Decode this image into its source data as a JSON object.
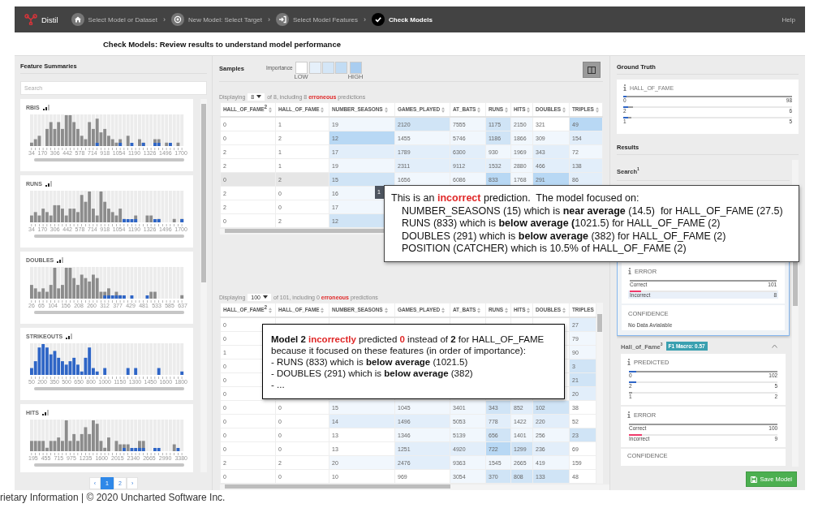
{
  "nav": {
    "brand": "Distil",
    "help": "Help",
    "steps": [
      {
        "label": "Select Model or Dataset",
        "selected": false
      },
      {
        "label": "New Model: Select Target",
        "sep": "›",
        "selected": false
      },
      {
        "label": "Select Model Features",
        "sep": "›",
        "selected": false
      },
      {
        "label": "Check Models",
        "sep": "›",
        "selected": true
      }
    ]
  },
  "page_title": "Check Models: Review results to understand model performance",
  "features": {
    "title": "Feature Summaries",
    "search": {
      "placeholder": "Search"
    },
    "items": [
      {
        "name": "RBIS",
        "level": 1,
        "ticks": [
          "34",
          "170",
          "306",
          "442",
          "578",
          "714",
          "918",
          "1054",
          "1190",
          "1326",
          "1496",
          "1700"
        ]
      },
      {
        "name": "RUNS",
        "level": 1,
        "ticks": [
          "34",
          "170",
          "306",
          "442",
          "578",
          "714",
          "918",
          "1054",
          "1190",
          "1326",
          "1496",
          "1700"
        ]
      },
      {
        "name": "DOUBLES",
        "level": 1,
        "ticks": [
          "26",
          "65",
          "104",
          "156",
          "208",
          "260",
          "312",
          "377",
          "429",
          "481",
          "533",
          "585",
          "637"
        ]
      },
      {
        "name": "STRIKEOUTS",
        "level": 1,
        "ticks": [
          "50",
          "200",
          "350",
          "500",
          "650",
          "800",
          "1000",
          "1150",
          "1300",
          "1450",
          "1600",
          "1800"
        ]
      },
      {
        "name": "HITS",
        "level": 1,
        "ticks": [
          "195",
          "455",
          "715",
          "975",
          "1235",
          "1600",
          "2015",
          "2340",
          "2665",
          "2990",
          "3380"
        ]
      }
    ],
    "prev": "‹",
    "next": "›",
    "pages": [
      {
        "label": "1",
        "selected": true
      },
      {
        "label": "2",
        "selected": false
      }
    ]
  },
  "samples": {
    "title": "Samples",
    "importance": {
      "label": "Importance",
      "low": "LOW",
      "high": "HIGH",
      "swatches": [
        {
          "color": "#ffffff"
        },
        {
          "color": "#e6f0fa"
        },
        {
          "color": "#d4e6f7"
        },
        {
          "color": "#c2dcf4"
        },
        {
          "color": "#a9cdf0"
        }
      ]
    },
    "tooltip": "1"
  },
  "tables": [
    {
      "displaying": "Displaying",
      "count": "8",
      "summary": [
        {
          "text": "of 8, including 8 ",
          "kind": "plain"
        },
        {
          "text": "erroneous",
          "kind": "red"
        },
        {
          "text": " predictions",
          "kind": "plain"
        }
      ],
      "columns": [
        "HALL_OF_FAME$^{2}$",
        "HALL_OF_FAME",
        "NUMBER_SEASONS",
        "GAMES_PLAYED",
        "AT_BATS",
        "RUNS",
        "HITS",
        "DOUBLES",
        "TRIPLES"
      ],
      "rows": [
        {
          "kind": "full",
          "selected": false,
          "cells": [
            {
              "text": "0"
            },
            {
              "text": "1"
            },
            {
              "text": "19",
              "color": "#f1f7fd"
            },
            {
              "text": "2120",
              "color": "#d0e4f6"
            },
            {
              "text": "7555",
              "color": "#f1f7fd"
            },
            {
              "text": "1175",
              "color": "#d0e4f6"
            },
            {
              "text": "2150",
              "color": "#f1f7fd"
            },
            {
              "text": "321"
            },
            {
              "text": "49",
              "color": "#b8d8f4"
            }
          ]
        },
        {
          "kind": "full",
          "selected": false,
          "cells": [
            {
              "text": "0"
            },
            {
              "text": "2"
            },
            {
              "text": "12",
              "color": "#b8d8f4"
            },
            {
              "text": "1455",
              "color": "#f1f7fd"
            },
            {
              "text": "5746",
              "color": "#f1f7fd"
            },
            {
              "text": "1186",
              "color": "#d0e4f6"
            },
            {
              "text": "1866",
              "color": "#f1f7fd"
            },
            {
              "text": "309",
              "color": "#f1f7fd"
            },
            {
              "text": "154",
              "color": "#e2eefa"
            }
          ]
        },
        {
          "kind": "full",
          "selected": false,
          "cells": [
            {
              "text": "2"
            },
            {
              "text": "1"
            },
            {
              "text": "17",
              "color": "#e2eefa"
            },
            {
              "text": "1789",
              "color": "#e2eefa"
            },
            {
              "text": "6300",
              "color": "#e2eefa"
            },
            {
              "text": "930",
              "color": "#f1f7fd"
            },
            {
              "text": "1969",
              "color": "#f1f7fd"
            },
            {
              "text": "343",
              "color": "#e2eefa"
            },
            {
              "text": "72",
              "color": "#f1f7fd"
            }
          ]
        },
        {
          "kind": "full",
          "selected": false,
          "cells": [
            {
              "text": "2"
            },
            {
              "text": "1"
            },
            {
              "text": "19",
              "color": "#f1f7fd"
            },
            {
              "text": "2311",
              "color": "#e2eefa"
            },
            {
              "text": "9112",
              "color": "#e2eefa"
            },
            {
              "text": "1532",
              "color": "#e2eefa"
            },
            {
              "text": "2880",
              "color": "#f1f7fd"
            },
            {
              "text": "466",
              "color": "#e2eefa"
            },
            {
              "text": "138",
              "color": "#e2eefa"
            }
          ]
        },
        {
          "kind": "full",
          "selected": true,
          "cells": [
            {
              "text": "0"
            },
            {
              "text": "2"
            },
            {
              "text": "15",
              "color": "#d0e4f6"
            },
            {
              "text": "1656",
              "color": "#f1f7fd"
            },
            {
              "text": "6086",
              "color": "#f1f7fd"
            },
            {
              "text": "833",
              "color": "#b8d8f4"
            },
            {
              "text": "1768",
              "color": "#f1f7fd"
            },
            {
              "text": "291",
              "color": "#b8d8f4"
            },
            {
              "text": "86",
              "color": "#e2eefa"
            }
          ]
        },
        {
          "kind": "left",
          "selected": false,
          "cells": [
            {
              "text": "2"
            },
            {
              "text": "0"
            },
            {
              "text": "16",
              "color": "#f1f7fd"
            }
          ]
        },
        {
          "kind": "left",
          "selected": false,
          "cells": [
            {
              "text": "2"
            },
            {
              "text": "0"
            },
            {
              "text": "17",
              "color": "#f1f7fd"
            }
          ]
        },
        {
          "kind": "left",
          "selected": false,
          "cells": [
            {
              "text": "0"
            },
            {
              "text": "2"
            },
            {
              "text": "12",
              "color": "#d0e4f6"
            }
          ]
        }
      ]
    },
    {
      "displaying": "Displaying",
      "count": "100",
      "summary": [
        {
          "text": "of 101, including 0 ",
          "kind": "plain"
        },
        {
          "text": "erroneous",
          "kind": "red"
        },
        {
          "text": " predictions",
          "kind": "plain"
        }
      ],
      "columns": [
        "HALL_OF_FAME$^{2}$",
        "HALL_OF_FAME",
        "NUMBER_SEASONS",
        "GAMES_PLAYED",
        "AT_BATS",
        "RUNS",
        "HITS",
        "DOUBLES",
        "TRIPLES"
      ],
      "rows": [
        {
          "kind": "split",
          "selected": false,
          "cells": [
            {
              "text": "0"
            },
            {
              "text": "27",
              "color": "#e2eefa"
            }
          ]
        },
        {
          "kind": "split",
          "selected": false,
          "cells": [
            {
              "text": "0"
            },
            {
              "text": "79",
              "color": "#f1f7fd"
            }
          ]
        },
        {
          "kind": "split",
          "selected": false,
          "cells": [
            {
              "text": "1"
            },
            {
              "text": "90",
              "color": "#f1f7fd"
            }
          ]
        },
        {
          "kind": "split",
          "selected": false,
          "cells": [
            {
              "text": "0"
            },
            {
              "text": "3",
              "color": "#d0e4f6"
            }
          ]
        },
        {
          "kind": "split",
          "selected": false,
          "cells": [
            {
              "text": "0"
            },
            {
              "text": "21",
              "color": "#d0e4f6"
            }
          ]
        },
        {
          "kind": "split",
          "selected": false,
          "cells": [
            {
              "text": "0"
            },
            {
              "text": "20",
              "color": "#e2eefa"
            }
          ]
        },
        {
          "kind": "full",
          "selected": false,
          "cells": [
            {
              "text": "0"
            },
            {
              "text": "0"
            },
            {
              "text": "15",
              "color": "#f1f7fd"
            },
            {
              "text": "1045",
              "color": "#f1f7fd"
            },
            {
              "text": "3401",
              "color": "#f1f7fd"
            },
            {
              "text": "343",
              "color": "#d0e4f6"
            },
            {
              "text": "852",
              "color": "#e2eefa"
            },
            {
              "text": "102",
              "color": "#d0e4f6"
            },
            {
              "text": "38"
            }
          ]
        },
        {
          "kind": "full",
          "selected": false,
          "cells": [
            {
              "text": "0"
            },
            {
              "text": "0"
            },
            {
              "text": "14",
              "color": "#e2eefa"
            },
            {
              "text": "1496",
              "color": "#e2eefa"
            },
            {
              "text": "5053",
              "color": "#f1f7fd"
            },
            {
              "text": "778",
              "color": "#e2eefa"
            },
            {
              "text": "1422",
              "color": "#f1f7fd"
            },
            {
              "text": "220",
              "color": "#e2eefa"
            },
            {
              "text": "52"
            }
          ]
        },
        {
          "kind": "full",
          "selected": false,
          "cells": [
            {
              "text": "0"
            },
            {
              "text": "0"
            },
            {
              "text": "13"
            },
            {
              "text": "1346",
              "color": "#f1f7fd"
            },
            {
              "text": "5139",
              "color": "#f1f7fd"
            },
            {
              "text": "656",
              "color": "#d0e4f6"
            },
            {
              "text": "1401",
              "color": "#f1f7fd"
            },
            {
              "text": "256",
              "color": "#f1f7fd"
            },
            {
              "text": "23",
              "color": "#d0e4f6"
            }
          ]
        },
        {
          "kind": "full",
          "selected": false,
          "cells": [
            {
              "text": "0"
            },
            {
              "text": "0"
            },
            {
              "text": "13"
            },
            {
              "text": "1251",
              "color": "#e2eefa"
            },
            {
              "text": "4920",
              "color": "#e2eefa"
            },
            {
              "text": "722",
              "color": "#b8d8f4"
            },
            {
              "text": "1299",
              "color": "#d0e4f6"
            },
            {
              "text": "236",
              "color": "#e2eefa"
            },
            {
              "text": "69"
            }
          ]
        },
        {
          "kind": "full",
          "selected": false,
          "cells": [
            {
              "text": "2"
            },
            {
              "text": "2"
            },
            {
              "text": "20",
              "color": "#f1f7fd"
            },
            {
              "text": "2476",
              "color": "#e2eefa"
            },
            {
              "text": "9363",
              "color": "#f1f7fd"
            },
            {
              "text": "1545",
              "color": "#f1f7fd"
            },
            {
              "text": "2665",
              "color": "#f1f7fd"
            },
            {
              "text": "419",
              "color": "#f1f7fd"
            },
            {
              "text": "159"
            }
          ]
        },
        {
          "kind": "full",
          "selected": false,
          "cells": [
            {
              "text": "0"
            },
            {
              "text": "0"
            },
            {
              "text": "10"
            },
            {
              "text": "969"
            },
            {
              "text": "3054",
              "color": "#f1f7fd"
            },
            {
              "text": "370",
              "color": "#d0e4f6"
            },
            {
              "text": "808",
              "color": "#d0e4f6"
            },
            {
              "text": "133",
              "color": "#d0e4f6"
            },
            {
              "text": "48"
            }
          ]
        }
      ]
    }
  ],
  "ground_truth": {
    "title": "Ground Truth",
    "label": "HALL_OF_FAME",
    "bars": [
      {
        "label": "0",
        "count": "98",
        "level": 1,
        "highlight": {
          "level": 0.02
        }
      },
      {
        "label": "2",
        "count": "6",
        "level": 0.06,
        "highlight": {
          "level": 0.03
        }
      },
      {
        "label": "1",
        "count": "5",
        "level": 0.05,
        "highlight": {
          "level": 0.03
        }
      }
    ]
  },
  "results": {
    "title": "Results",
    "search": {
      "title": "Search",
      "sup": "1",
      "error": {
        "label": "ERROR",
        "bars": [
          {
            "label": "Correct",
            "count": "101",
            "level": 1,
            "kind": "neutral",
            "selected": false
          },
          {
            "label": "Incorrect",
            "count": "8",
            "level": 0.08,
            "kind": "error",
            "selected": true
          }
        ]
      },
      "confidence": {
        "label": "CONFIDENCE",
        "note": "No Data Avialable"
      }
    },
    "model": {
      "title": "Hall_of_Fame",
      "sup": "3",
      "badge": "F1 Macro: 0.57",
      "expanded": true,
      "predicted": {
        "label": "PREDICTED",
        "bars": [
          {
            "label": "0",
            "count": "102",
            "level": 1,
            "highlight": {
              "level": 0.05
            }
          },
          {
            "label": "2",
            "count": "5",
            "level": 0.05,
            "highlight": {
              "level": 0.05
            }
          },
          {
            "label": "1",
            "count": "2",
            "level": 0.02
          }
        ]
      },
      "error": {
        "label": "ERROR",
        "bars": [
          {
            "label": "Correct",
            "count": "100",
            "level": 1,
            "kind": "neutral",
            "selected": false
          },
          {
            "label": "Incorrect",
            "count": "9",
            "level": 0.09,
            "kind": "error",
            "selected": false
          }
        ]
      },
      "confidence": {
        "label": "CONFIDENCE"
      }
    }
  },
  "save": "Save Model",
  "callouts": [
    {
      "kind": "top",
      "lines": [
        {
          "indent": false,
          "segments": [
            {
              "text": "This is an ",
              "kind": "plain"
            },
            {
              "text": "incorrect",
              "kind": "red"
            },
            {
              "text": " prediction.  The model focused on:",
              "kind": "plain"
            }
          ]
        },
        {
          "indent": true,
          "segments": [
            {
              "text": "NUMBER_SEASONS (15) which is ",
              "kind": "plain"
            },
            {
              "text": "near average",
              "kind": "bold"
            },
            {
              "text": " (14.5)  for HALL_OF_FAME (27.5)",
              "kind": "plain"
            }
          ]
        },
        {
          "indent": true,
          "segments": [
            {
              "text": "RUNS (833) which is ",
              "kind": "plain"
            },
            {
              "text": "below average (",
              "kind": "bold"
            },
            {
              "text": "1021.5) for HALL_OF_FAME (2)",
              "kind": "plain"
            }
          ]
        },
        {
          "indent": true,
          "segments": [
            {
              "text": "DOUBLES (291) which is ",
              "kind": "plain"
            },
            {
              "text": "below average",
              "kind": "bold"
            },
            {
              "text": " (382) for HALL_OF_FAME (2)",
              "kind": "plain"
            }
          ]
        },
        {
          "indent": true,
          "segments": [
            {
              "text": "POSITION (CATCHER) which is 10.5% of HALL_OF_FAME (2)",
              "kind": "plain"
            }
          ]
        }
      ]
    },
    {
      "kind": "bottom",
      "lines": [
        {
          "indent": false,
          "segments": [
            {
              "text": "Model 2",
              "kind": "bold"
            },
            {
              "text": " incorrectly",
              "kind": "red"
            },
            {
              "text": " predicted ",
              "kind": "plain"
            },
            {
              "text": "0",
              "kind": "red"
            },
            {
              "text": " instead of ",
              "kind": "plain"
            },
            {
              "text": "2",
              "kind": "bold"
            },
            {
              "text": " for HALL_OF_FAME",
              "kind": "plain"
            }
          ]
        },
        {
          "indent": false,
          "segments": [
            {
              "text": "because it focused on these features (in order of importance):",
              "kind": "plain"
            }
          ]
        },
        {
          "indent": false,
          "segments": [
            {
              "text": "- RUNS (833) which is ",
              "kind": "plain"
            },
            {
              "text": "below average",
              "kind": "bold"
            },
            {
              "text": " (1021.5)",
              "kind": "plain"
            }
          ]
        },
        {
          "indent": false,
          "segments": [
            {
              "text": "- DOUBLES (291) which is ",
              "kind": "plain"
            },
            {
              "text": "below average",
              "kind": "bold"
            },
            {
              "text": " (382)",
              "kind": "plain"
            }
          ]
        },
        {
          "indent": false,
          "segments": [
            {
              "text": "- ...",
              "kind": "plain"
            }
          ]
        }
      ]
    }
  ],
  "footer": "rietary Information | © 2020 Uncharted Software Inc."
}
